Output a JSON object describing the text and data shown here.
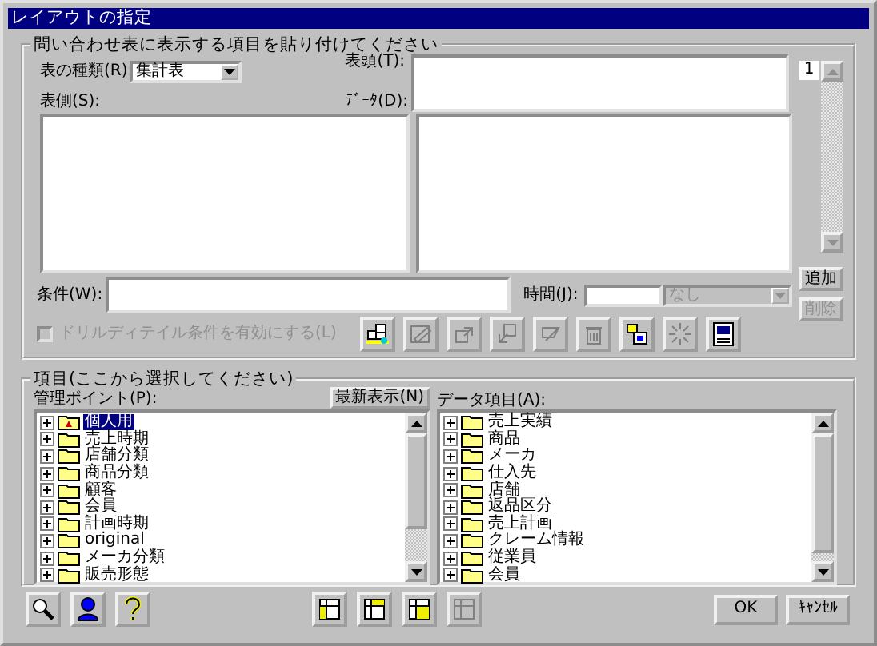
{
  "window": {
    "title": "レイアウトの指定"
  },
  "layout_group": {
    "title": "問い合わせ表に表示する項目を貼り付けてください",
    "table_type": {
      "label": "表の種類(R):",
      "value": "集計表"
    },
    "row_header_label": "表側(S):",
    "column_header_label": "表頭(T):",
    "data_label": "ﾃﾞｰﾀ(D):",
    "page": "1",
    "add_button": {
      "label": "追加",
      "disabled": false
    },
    "delete_button": {
      "label": "削除",
      "disabled": true
    },
    "condition": {
      "label": "条件(W):"
    },
    "time": {
      "label": "時間(J):",
      "value": "なし",
      "disabled": true
    },
    "drill_checkbox": {
      "label": "ドリルディテイル条件を有効にする(L)",
      "checked": false,
      "disabled": true
    },
    "tools": [
      {
        "kind": "layout",
        "disabled": false
      },
      {
        "kind": "edit",
        "disabled": true
      },
      {
        "kind": "up",
        "disabled": true
      },
      {
        "kind": "down",
        "disabled": true
      },
      {
        "kind": "clear",
        "disabled": true
      },
      {
        "kind": "trash",
        "disabled": true
      },
      {
        "kind": "swap",
        "disabled": false
      },
      {
        "kind": "burst",
        "disabled": true
      },
      {
        "kind": "preview",
        "disabled": false
      }
    ]
  },
  "items_group": {
    "title": "項目(ここから選択してください)",
    "refresh_button": "最新表示(N)",
    "management_points": {
      "label": "管理ポイント(P):",
      "items": [
        {
          "label": "個人用",
          "kind": "personal",
          "selected": true,
          "expanded": false
        },
        {
          "label": "売上時期",
          "kind": "folder",
          "selected": false,
          "expanded": false
        },
        {
          "label": "店舗分類",
          "kind": "folder",
          "selected": false,
          "expanded": false
        },
        {
          "label": "商品分類",
          "kind": "folder",
          "selected": false,
          "expanded": false
        },
        {
          "label": "顧客",
          "kind": "folder",
          "selected": false,
          "expanded": false
        },
        {
          "label": "会員",
          "kind": "folder",
          "selected": false,
          "expanded": false
        },
        {
          "label": "計画時期",
          "kind": "folder",
          "selected": false,
          "expanded": false
        },
        {
          "label": "original",
          "kind": "folder",
          "selected": false,
          "expanded": false
        },
        {
          "label": "メーカ分類",
          "kind": "folder",
          "selected": false,
          "expanded": false
        },
        {
          "label": "販売形態",
          "kind": "folder",
          "selected": false,
          "expanded": false
        }
      ]
    },
    "data_items": {
      "label": "データ項目(A):",
      "items": [
        {
          "label": "売上実績",
          "kind": "folder",
          "selected": false,
          "expanded": false
        },
        {
          "label": "商品",
          "kind": "folder",
          "selected": false,
          "expanded": false
        },
        {
          "label": "メーカ",
          "kind": "folder",
          "selected": false,
          "expanded": false
        },
        {
          "label": "仕入先",
          "kind": "folder",
          "selected": false,
          "expanded": false
        },
        {
          "label": "店舗",
          "kind": "folder",
          "selected": false,
          "expanded": false
        },
        {
          "label": "返品区分",
          "kind": "folder",
          "selected": false,
          "expanded": false
        },
        {
          "label": "売上計画",
          "kind": "folder",
          "selected": false,
          "expanded": false
        },
        {
          "label": "クレーム情報",
          "kind": "folder",
          "selected": false,
          "expanded": false
        },
        {
          "label": "従業員",
          "kind": "folder",
          "selected": false,
          "expanded": false
        },
        {
          "label": "会員",
          "kind": "folder",
          "selected": false,
          "expanded": false
        }
      ]
    }
  },
  "bottom_tools": [
    {
      "kind": "search",
      "disabled": false
    },
    {
      "kind": "person",
      "disabled": false
    },
    {
      "kind": "question",
      "disabled": false
    }
  ],
  "place_tools": [
    {
      "kind": "place-left",
      "disabled": false
    },
    {
      "kind": "place-top",
      "disabled": false
    },
    {
      "kind": "place-data",
      "disabled": false
    },
    {
      "kind": "place-bottom",
      "disabled": true
    }
  ],
  "buttons": [
    {
      "label": "OK"
    },
    {
      "label": "ｷｬﾝｾﾙ"
    }
  ]
}
